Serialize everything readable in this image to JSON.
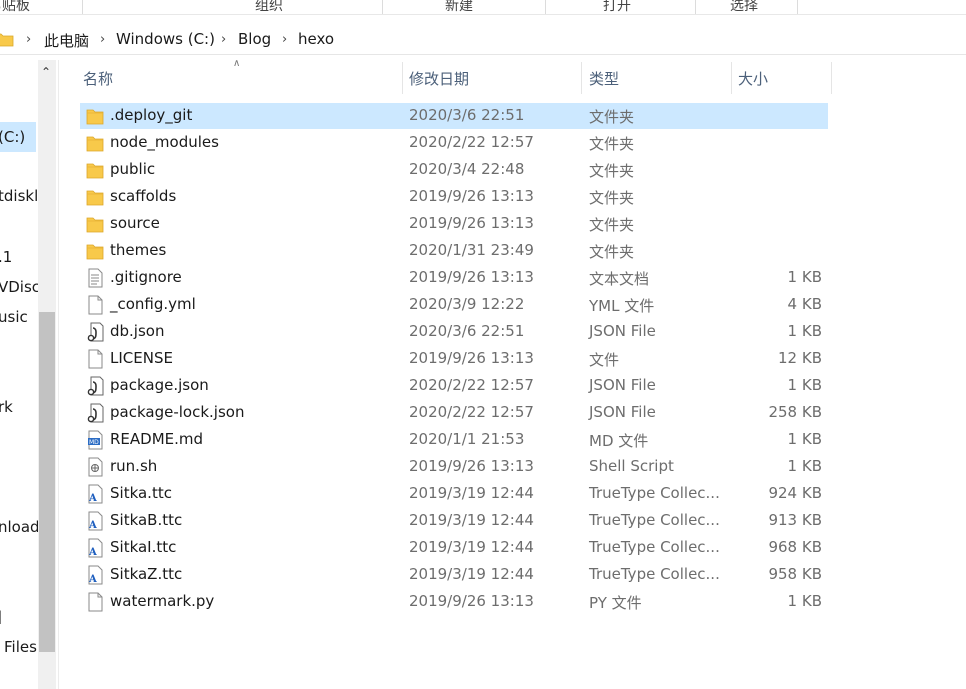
{
  "ribbon": {
    "groups": [
      "剪贴板",
      "组织",
      "新建",
      "打开",
      "选择"
    ]
  },
  "address": {
    "crumbs": [
      "此电脑",
      "Windows (C:)",
      "Blog",
      "hexo"
    ]
  },
  "nav": {
    "items": [
      "(C:)",
      "tdiskl",
      ".1",
      "VDisc",
      "usic",
      "rk",
      "nload",
      "]",
      "Files"
    ]
  },
  "columns": {
    "name": "名称",
    "date": "修改日期",
    "type": "类型",
    "size": "大小"
  },
  "files": [
    {
      "name": ".deploy_git",
      "date": "2020/3/6 22:51",
      "type": "文件夹",
      "size": "",
      "icon": "folder-icon"
    },
    {
      "name": "node_modules",
      "date": "2020/2/22 12:57",
      "type": "文件夹",
      "size": "",
      "icon": "folder-icon"
    },
    {
      "name": "public",
      "date": "2020/3/4 22:48",
      "type": "文件夹",
      "size": "",
      "icon": "folder-icon"
    },
    {
      "name": "scaffolds",
      "date": "2019/9/26 13:13",
      "type": "文件夹",
      "size": "",
      "icon": "folder-icon"
    },
    {
      "name": "source",
      "date": "2019/9/26 13:13",
      "type": "文件夹",
      "size": "",
      "icon": "folder-icon"
    },
    {
      "name": "themes",
      "date": "2020/1/31 23:49",
      "type": "文件夹",
      "size": "",
      "icon": "folder-icon"
    },
    {
      "name": ".gitignore",
      "date": "2019/9/26 13:13",
      "type": "文本文档",
      "size": "1 KB",
      "icon": "text-file-icon"
    },
    {
      "name": "_config.yml",
      "date": "2020/3/9 12:22",
      "type": "YML 文件",
      "size": "4 KB",
      "icon": "blank-file-icon"
    },
    {
      "name": "db.json",
      "date": "2020/3/6 22:51",
      "type": "JSON File",
      "size": "1 KB",
      "icon": "json-file-icon"
    },
    {
      "name": "LICENSE",
      "date": "2019/9/26 13:13",
      "type": "文件",
      "size": "12 KB",
      "icon": "blank-file-icon"
    },
    {
      "name": "package.json",
      "date": "2020/2/22 12:57",
      "type": "JSON File",
      "size": "1 KB",
      "icon": "json-file-icon"
    },
    {
      "name": "package-lock.json",
      "date": "2020/2/22 12:57",
      "type": "JSON File",
      "size": "258 KB",
      "icon": "json-file-icon"
    },
    {
      "name": "README.md",
      "date": "2020/1/1 21:53",
      "type": "MD 文件",
      "size": "1 KB",
      "icon": "markdown-file-icon"
    },
    {
      "name": "run.sh",
      "date": "2019/9/26 13:13",
      "type": "Shell Script",
      "size": "1 KB",
      "icon": "shell-file-icon"
    },
    {
      "name": "Sitka.ttc",
      "date": "2019/3/19 12:44",
      "type": "TrueType Collec...",
      "size": "924 KB",
      "icon": "font-file-icon"
    },
    {
      "name": "SitkaB.ttc",
      "date": "2019/3/19 12:44",
      "type": "TrueType Collec...",
      "size": "913 KB",
      "icon": "font-file-icon"
    },
    {
      "name": "SitkaI.ttc",
      "date": "2019/3/19 12:44",
      "type": "TrueType Collec...",
      "size": "968 KB",
      "icon": "font-file-icon"
    },
    {
      "name": "SitkaZ.ttc",
      "date": "2019/3/19 12:44",
      "type": "TrueType Collec...",
      "size": "958 KB",
      "icon": "font-file-icon"
    },
    {
      "name": "watermark.py",
      "date": "2019/9/26 13:13",
      "type": "PY 文件",
      "size": "1 KB",
      "icon": "blank-file-icon"
    }
  ],
  "selected_index": 0,
  "colors": {
    "selection": "#cce8ff",
    "folder": "#f8c94a",
    "header_text": "#4c607a"
  }
}
